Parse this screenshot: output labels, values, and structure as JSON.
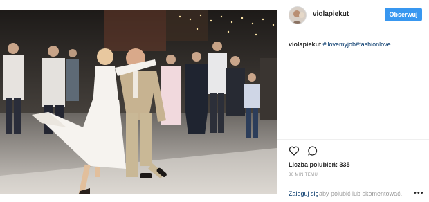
{
  "post": {
    "username": "violapiekut",
    "follow_label": "Obserwuj",
    "caption": {
      "user": "violapiekut",
      "tags": [
        "#ilovemyjob",
        "#fashionlove"
      ]
    },
    "likes_label": "Liczba polubień:",
    "likes_count": "335",
    "time_ago": "36 MIN TEMU",
    "login_link": "Zaloguj się",
    "login_text": ", aby polubić lub skomentować.",
    "more_label": "•••",
    "icons": {
      "like": "heart-icon",
      "comment": "comment-icon",
      "more": "more-options-icon"
    },
    "colors": {
      "follow_button": "#3897f0",
      "link": "#003569",
      "muted": "#999999"
    }
  }
}
